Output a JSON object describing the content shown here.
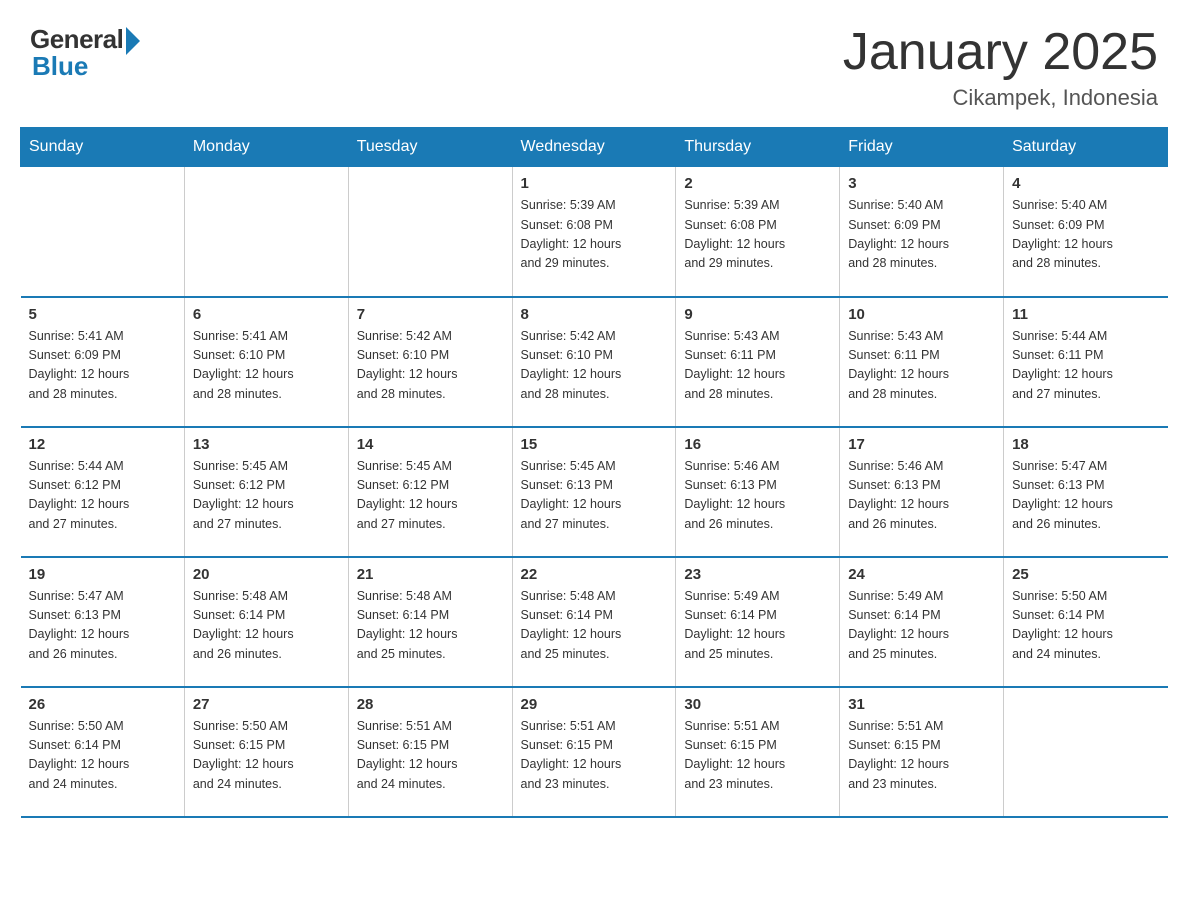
{
  "logo": {
    "general": "General",
    "blue": "Blue"
  },
  "header": {
    "title": "January 2025",
    "subtitle": "Cikampek, Indonesia"
  },
  "days_of_week": [
    "Sunday",
    "Monday",
    "Tuesday",
    "Wednesday",
    "Thursday",
    "Friday",
    "Saturday"
  ],
  "weeks": [
    [
      {
        "day": "",
        "info": ""
      },
      {
        "day": "",
        "info": ""
      },
      {
        "day": "",
        "info": ""
      },
      {
        "day": "1",
        "info": "Sunrise: 5:39 AM\nSunset: 6:08 PM\nDaylight: 12 hours\nand 29 minutes."
      },
      {
        "day": "2",
        "info": "Sunrise: 5:39 AM\nSunset: 6:08 PM\nDaylight: 12 hours\nand 29 minutes."
      },
      {
        "day": "3",
        "info": "Sunrise: 5:40 AM\nSunset: 6:09 PM\nDaylight: 12 hours\nand 28 minutes."
      },
      {
        "day": "4",
        "info": "Sunrise: 5:40 AM\nSunset: 6:09 PM\nDaylight: 12 hours\nand 28 minutes."
      }
    ],
    [
      {
        "day": "5",
        "info": "Sunrise: 5:41 AM\nSunset: 6:09 PM\nDaylight: 12 hours\nand 28 minutes."
      },
      {
        "day": "6",
        "info": "Sunrise: 5:41 AM\nSunset: 6:10 PM\nDaylight: 12 hours\nand 28 minutes."
      },
      {
        "day": "7",
        "info": "Sunrise: 5:42 AM\nSunset: 6:10 PM\nDaylight: 12 hours\nand 28 minutes."
      },
      {
        "day": "8",
        "info": "Sunrise: 5:42 AM\nSunset: 6:10 PM\nDaylight: 12 hours\nand 28 minutes."
      },
      {
        "day": "9",
        "info": "Sunrise: 5:43 AM\nSunset: 6:11 PM\nDaylight: 12 hours\nand 28 minutes."
      },
      {
        "day": "10",
        "info": "Sunrise: 5:43 AM\nSunset: 6:11 PM\nDaylight: 12 hours\nand 28 minutes."
      },
      {
        "day": "11",
        "info": "Sunrise: 5:44 AM\nSunset: 6:11 PM\nDaylight: 12 hours\nand 27 minutes."
      }
    ],
    [
      {
        "day": "12",
        "info": "Sunrise: 5:44 AM\nSunset: 6:12 PM\nDaylight: 12 hours\nand 27 minutes."
      },
      {
        "day": "13",
        "info": "Sunrise: 5:45 AM\nSunset: 6:12 PM\nDaylight: 12 hours\nand 27 minutes."
      },
      {
        "day": "14",
        "info": "Sunrise: 5:45 AM\nSunset: 6:12 PM\nDaylight: 12 hours\nand 27 minutes."
      },
      {
        "day": "15",
        "info": "Sunrise: 5:45 AM\nSunset: 6:13 PM\nDaylight: 12 hours\nand 27 minutes."
      },
      {
        "day": "16",
        "info": "Sunrise: 5:46 AM\nSunset: 6:13 PM\nDaylight: 12 hours\nand 26 minutes."
      },
      {
        "day": "17",
        "info": "Sunrise: 5:46 AM\nSunset: 6:13 PM\nDaylight: 12 hours\nand 26 minutes."
      },
      {
        "day": "18",
        "info": "Sunrise: 5:47 AM\nSunset: 6:13 PM\nDaylight: 12 hours\nand 26 minutes."
      }
    ],
    [
      {
        "day": "19",
        "info": "Sunrise: 5:47 AM\nSunset: 6:13 PM\nDaylight: 12 hours\nand 26 minutes."
      },
      {
        "day": "20",
        "info": "Sunrise: 5:48 AM\nSunset: 6:14 PM\nDaylight: 12 hours\nand 26 minutes."
      },
      {
        "day": "21",
        "info": "Sunrise: 5:48 AM\nSunset: 6:14 PM\nDaylight: 12 hours\nand 25 minutes."
      },
      {
        "day": "22",
        "info": "Sunrise: 5:48 AM\nSunset: 6:14 PM\nDaylight: 12 hours\nand 25 minutes."
      },
      {
        "day": "23",
        "info": "Sunrise: 5:49 AM\nSunset: 6:14 PM\nDaylight: 12 hours\nand 25 minutes."
      },
      {
        "day": "24",
        "info": "Sunrise: 5:49 AM\nSunset: 6:14 PM\nDaylight: 12 hours\nand 25 minutes."
      },
      {
        "day": "25",
        "info": "Sunrise: 5:50 AM\nSunset: 6:14 PM\nDaylight: 12 hours\nand 24 minutes."
      }
    ],
    [
      {
        "day": "26",
        "info": "Sunrise: 5:50 AM\nSunset: 6:14 PM\nDaylight: 12 hours\nand 24 minutes."
      },
      {
        "day": "27",
        "info": "Sunrise: 5:50 AM\nSunset: 6:15 PM\nDaylight: 12 hours\nand 24 minutes."
      },
      {
        "day": "28",
        "info": "Sunrise: 5:51 AM\nSunset: 6:15 PM\nDaylight: 12 hours\nand 24 minutes."
      },
      {
        "day": "29",
        "info": "Sunrise: 5:51 AM\nSunset: 6:15 PM\nDaylight: 12 hours\nand 23 minutes."
      },
      {
        "day": "30",
        "info": "Sunrise: 5:51 AM\nSunset: 6:15 PM\nDaylight: 12 hours\nand 23 minutes."
      },
      {
        "day": "31",
        "info": "Sunrise: 5:51 AM\nSunset: 6:15 PM\nDaylight: 12 hours\nand 23 minutes."
      },
      {
        "day": "",
        "info": ""
      }
    ]
  ]
}
